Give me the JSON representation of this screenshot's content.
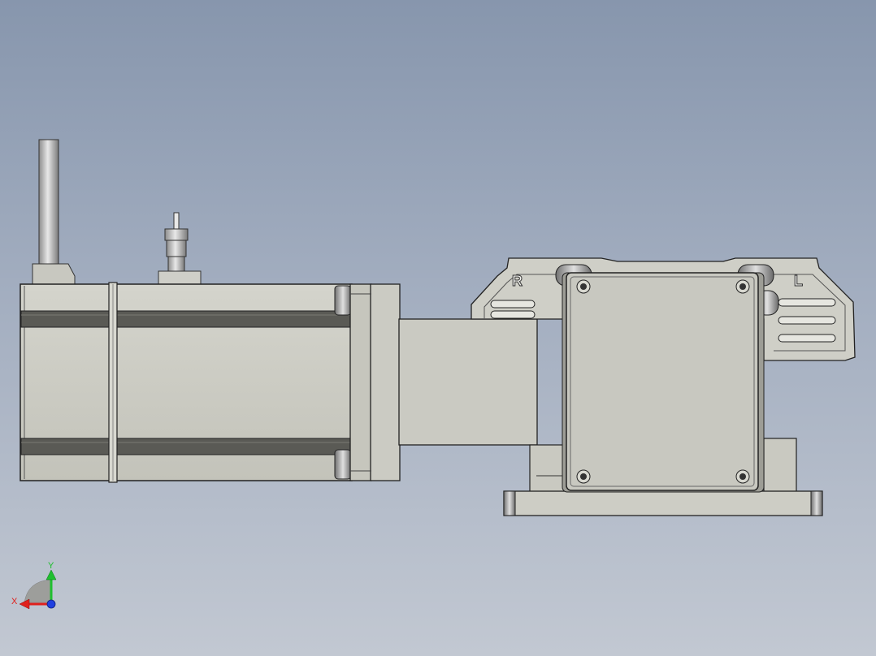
{
  "viewport": {
    "background_top": "#8796ad",
    "background_bottom": "#c2c8d2"
  },
  "model": {
    "body_color": "#c9c9c1",
    "body_shade": "#b4b4ab",
    "band_color": "#5a5a55",
    "outline_color": "#222222",
    "rod_color": "#bfbfbf",
    "labels": {
      "right": "R",
      "left": "L"
    }
  },
  "triad": {
    "x_label": "X",
    "y_label": "Y",
    "x_color": "#e0201c",
    "y_color": "#1fbf2f",
    "z_color": "#2040e0"
  }
}
